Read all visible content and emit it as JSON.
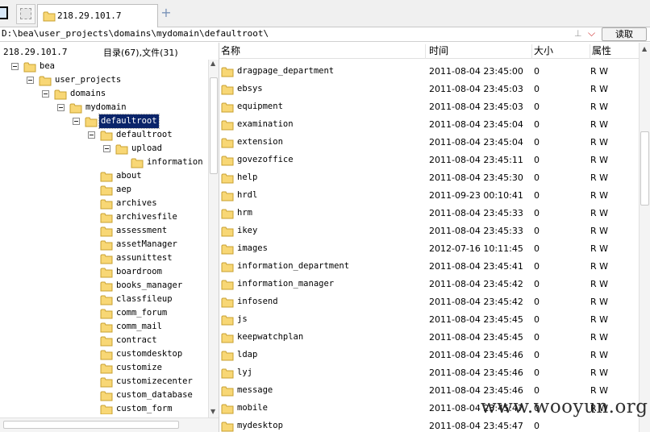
{
  "tabs": [
    {
      "label": "218.29.101.7",
      "active": true
    }
  ],
  "pathbar": {
    "path": "D:\\bea\\user_projects\\domains\\mydomain\\defaultroot\\",
    "arrows": "⊥",
    "read_label": "读取"
  },
  "left_panel": {
    "host": "218.29.101.7",
    "stats": "目录(67),文件(31)"
  },
  "tree": [
    {
      "label": "bea",
      "level": 0,
      "expander": true
    },
    {
      "label": "user_projects",
      "level": 1,
      "expander": true
    },
    {
      "label": "domains",
      "level": 2,
      "expander": true
    },
    {
      "label": "mydomain",
      "level": 3,
      "expander": true
    },
    {
      "label": "defaultroot",
      "level": 4,
      "expander": true,
      "selected": true
    },
    {
      "label": "defaultroot",
      "level": 5,
      "expander": true
    },
    {
      "label": "upload",
      "level": 6,
      "expander": true
    },
    {
      "label": "information",
      "level": 7,
      "expander": false
    },
    {
      "label": "about",
      "level": 5,
      "expander": false
    },
    {
      "label": "aep",
      "level": 5,
      "expander": false
    },
    {
      "label": "archives",
      "level": 5,
      "expander": false
    },
    {
      "label": "archivesfile",
      "level": 5,
      "expander": false
    },
    {
      "label": "assessment",
      "level": 5,
      "expander": false
    },
    {
      "label": "assetManager",
      "level": 5,
      "expander": false
    },
    {
      "label": "assunittest",
      "level": 5,
      "expander": false
    },
    {
      "label": "boardroom",
      "level": 5,
      "expander": false
    },
    {
      "label": "books_manager",
      "level": 5,
      "expander": false
    },
    {
      "label": "classfileup",
      "level": 5,
      "expander": false
    },
    {
      "label": "comm_forum",
      "level": 5,
      "expander": false
    },
    {
      "label": "comm_mail",
      "level": 5,
      "expander": false
    },
    {
      "label": "contract",
      "level": 5,
      "expander": false
    },
    {
      "label": "customdesktop",
      "level": 5,
      "expander": false
    },
    {
      "label": "customize",
      "level": 5,
      "expander": false
    },
    {
      "label": "customizecenter",
      "level": 5,
      "expander": false
    },
    {
      "label": "custom_database",
      "level": 5,
      "expander": false
    },
    {
      "label": "custom_form",
      "level": 5,
      "expander": false
    }
  ],
  "columns": {
    "name": "名称",
    "time": "时间",
    "size": "大小",
    "attr": "属性"
  },
  "files": [
    {
      "name": "dragpage_department",
      "time": "2011-08-04 23:45:00",
      "size": "0",
      "attr": "R W"
    },
    {
      "name": "ebsys",
      "time": "2011-08-04 23:45:03",
      "size": "0",
      "attr": "R W"
    },
    {
      "name": "equipment",
      "time": "2011-08-04 23:45:03",
      "size": "0",
      "attr": "R W"
    },
    {
      "name": "examination",
      "time": "2011-08-04 23:45:04",
      "size": "0",
      "attr": "R W"
    },
    {
      "name": "extension",
      "time": "2011-08-04 23:45:04",
      "size": "0",
      "attr": "R W"
    },
    {
      "name": "govezoffice",
      "time": "2011-08-04 23:45:11",
      "size": "0",
      "attr": "R W"
    },
    {
      "name": "help",
      "time": "2011-08-04 23:45:30",
      "size": "0",
      "attr": "R W"
    },
    {
      "name": "hrdl",
      "time": "2011-09-23 00:10:41",
      "size": "0",
      "attr": "R W"
    },
    {
      "name": "hrm",
      "time": "2011-08-04 23:45:33",
      "size": "0",
      "attr": "R W"
    },
    {
      "name": "ikey",
      "time": "2011-08-04 23:45:33",
      "size": "0",
      "attr": "R W"
    },
    {
      "name": "images",
      "time": "2012-07-16 10:11:45",
      "size": "0",
      "attr": "R W"
    },
    {
      "name": "information_department",
      "time": "2011-08-04 23:45:41",
      "size": "0",
      "attr": "R W"
    },
    {
      "name": "information_manager",
      "time": "2011-08-04 23:45:42",
      "size": "0",
      "attr": "R W"
    },
    {
      "name": "infosend",
      "time": "2011-08-04 23:45:42",
      "size": "0",
      "attr": "R W"
    },
    {
      "name": "js",
      "time": "2011-08-04 23:45:45",
      "size": "0",
      "attr": "R W"
    },
    {
      "name": "keepwatchplan",
      "time": "2011-08-04 23:45:45",
      "size": "0",
      "attr": "R W"
    },
    {
      "name": "ldap",
      "time": "2011-08-04 23:45:46",
      "size": "0",
      "attr": "R W"
    },
    {
      "name": "lyj",
      "time": "2011-08-04 23:45:46",
      "size": "0",
      "attr": "R W"
    },
    {
      "name": "message",
      "time": "2011-08-04 23:45:46",
      "size": "0",
      "attr": "R W"
    },
    {
      "name": "mobile",
      "time": "2011-08-04 23:45:47",
      "size": "0",
      "attr": "R W"
    },
    {
      "name": "mydesktop",
      "time": "2011-08-04 23:45:47",
      "size": "0",
      "attr": ""
    }
  ],
  "watermark": "www.wooyun.org",
  "colors": {
    "selection": "#0a246a",
    "folder_fill": "#f8d775",
    "folder_stroke": "#c8a030",
    "accent": "#7a93b8"
  }
}
